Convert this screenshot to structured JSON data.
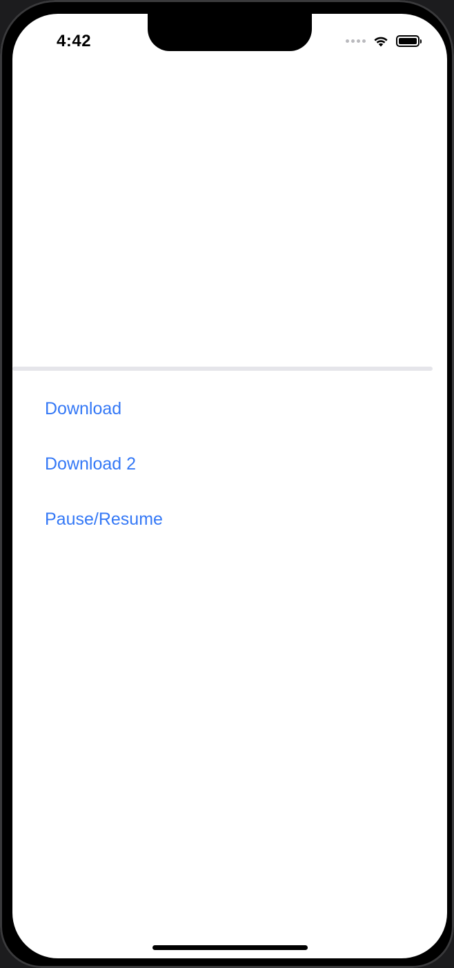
{
  "status_bar": {
    "time": "4:42",
    "signal_icon": "signal-dots-icon",
    "wifi_icon": "wifi-icon",
    "battery_icon": "battery-icon"
  },
  "progress": {
    "value": 0
  },
  "buttons": {
    "download": "Download",
    "download2": "Download 2",
    "pause_resume": "Pause/Resume"
  },
  "colors": {
    "accent": "#3478f6",
    "track": "#e5e5ea",
    "background": "#ffffff"
  }
}
